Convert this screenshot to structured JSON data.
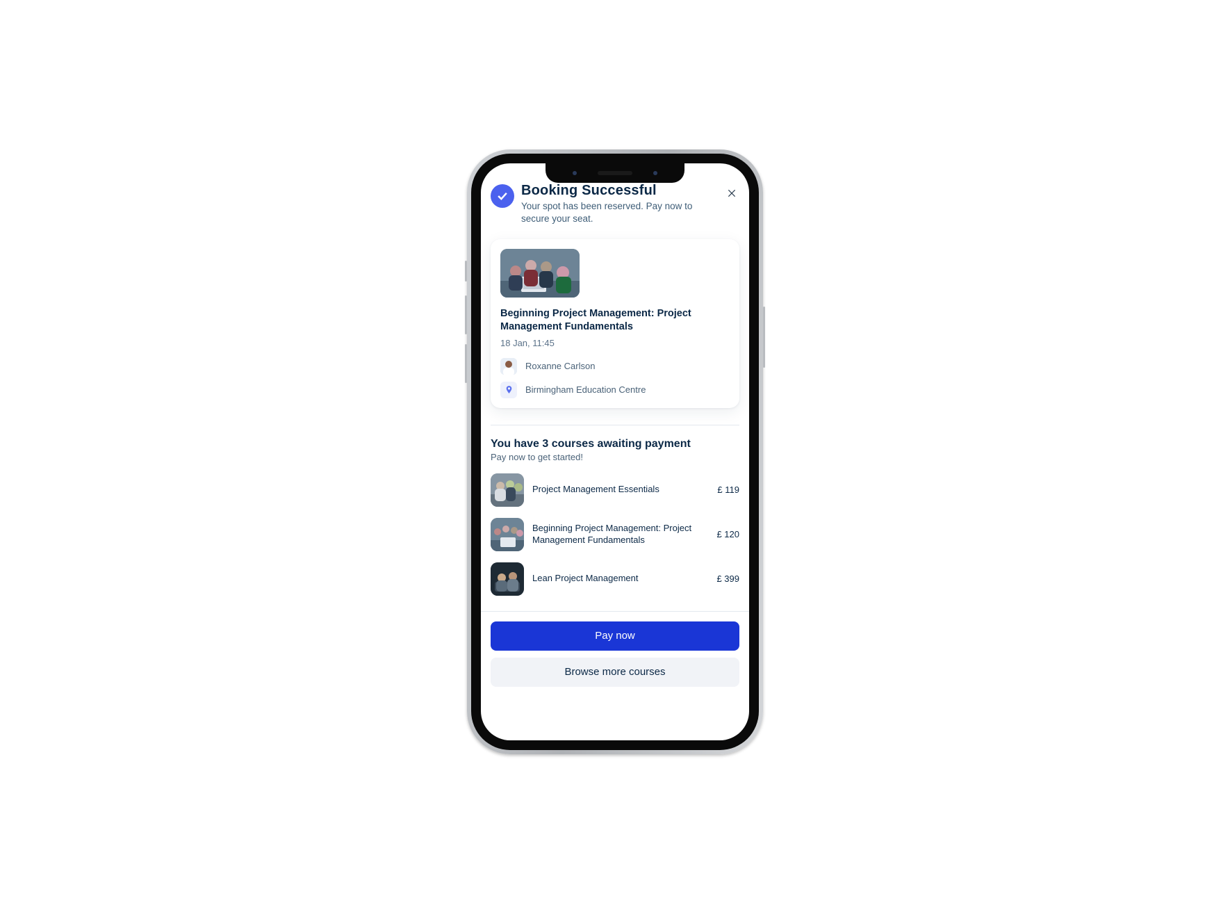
{
  "header": {
    "title": "Booking Successful",
    "subtitle": "Your spot has been reserved. Pay now to secure your seat."
  },
  "booking": {
    "course_title": "Beginning Project Management: Project Management Fundamentals",
    "datetime": "18 Jan, 11:45",
    "instructor": "Roxanne Carlson",
    "location": "Birmingham Education Centre"
  },
  "awaiting": {
    "title": "You have 3 courses awaiting payment",
    "subtitle": "Pay now to get started!",
    "items": [
      {
        "name": "Project Management Essentials",
        "price": "£ 119"
      },
      {
        "name": "Beginning Project Management: Project Management Fundamentals",
        "price": "£ 120"
      },
      {
        "name": "Lean Project Management",
        "price": "£ 399"
      }
    ]
  },
  "footer": {
    "pay_label": "Pay now",
    "browse_label": "Browse more courses"
  },
  "colors": {
    "primary": "#1a36d6",
    "accent": "#4b61ee",
    "text_dark": "#0b2846",
    "text_muted": "#4a6278"
  }
}
